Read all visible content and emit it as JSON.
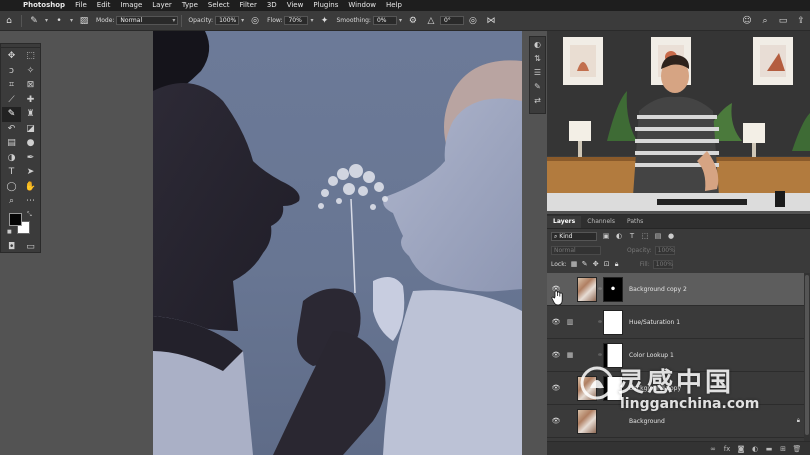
{
  "menubar": {
    "app_name": "Photoshop",
    "items": [
      "File",
      "Edit",
      "Image",
      "Layer",
      "Type",
      "Select",
      "Filter",
      "3D",
      "View",
      "Plugins",
      "Window",
      "Help"
    ]
  },
  "options_bar": {
    "mode_label": "Mode:",
    "mode_value": "Normal",
    "opacity_label": "Opacity:",
    "opacity_value": "100%",
    "flow_label": "Flow:",
    "flow_value": "70%",
    "smoothing_label": "Smoothing:",
    "smoothing_value": "0%",
    "angle_value": "0°"
  },
  "tools": {
    "icons": [
      "move-icon",
      "marquee-icon",
      "lasso-icon",
      "magic-wand-icon",
      "crop-icon",
      "frame-icon",
      "eyedropper-icon",
      "healing-icon",
      "brush-icon",
      "stamp-icon",
      "history-brush-icon",
      "eraser-icon",
      "gradient-icon",
      "blur-icon",
      "dodge-icon",
      "pen-icon",
      "type-icon",
      "path-select-icon",
      "shape-icon",
      "hand-icon",
      "zoom-icon",
      "more-icon"
    ],
    "active": "brush-icon",
    "foreground_color": "#050505",
    "background_color": "#ffffff"
  },
  "layers_panel": {
    "tabs": [
      "Layers",
      "Channels",
      "Paths"
    ],
    "active_tab": "Layers",
    "filter_kind": "Kind",
    "blend_mode": "Normal",
    "opacity_label": "Opacity:",
    "opacity_value": "100%",
    "lock_label": "Lock:",
    "fill_label": "Fill:",
    "fill_value": "100%",
    "layers": [
      {
        "name": "Background copy 2",
        "type": "pixel-with-mask",
        "selected": true
      },
      {
        "name": "Hue/Saturation 1",
        "type": "adjustment",
        "selected": false
      },
      {
        "name": "Color Lookup 1",
        "type": "adjustment",
        "selected": false
      },
      {
        "name": "Background copy",
        "type": "pixel-with-mask",
        "selected": false
      },
      {
        "name": "Background",
        "type": "background",
        "selected": false
      }
    ]
  },
  "watermark": {
    "title": "灵感中国",
    "url": "lingganchina.com"
  },
  "colors": {
    "menubar_bg": "#1e1e1e",
    "panel_bg": "#3a3a3a",
    "workspace_bg": "#535353",
    "selected_layer_bg": "#5d5d5d"
  }
}
